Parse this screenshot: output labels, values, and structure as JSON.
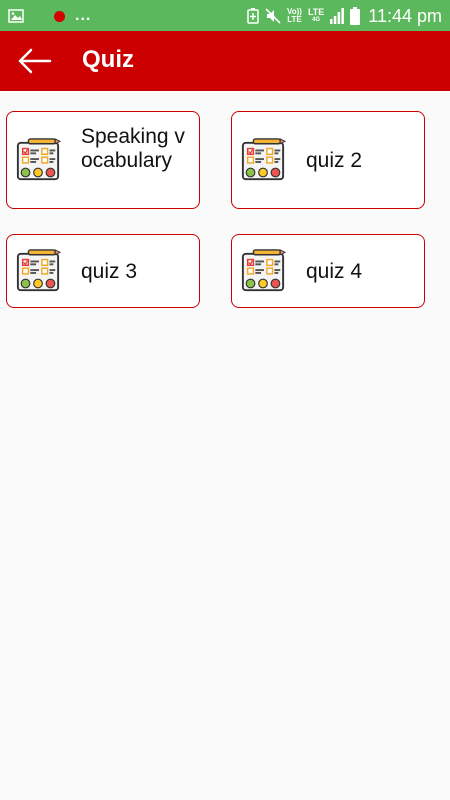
{
  "status_bar": {
    "time": "11:44 pm",
    "volte_top": "Vo))",
    "volte_bottom": "LTE",
    "lte_top": "LTE",
    "lte_bottom": "4G",
    "icons": [
      "gallery-icon",
      "recording-dot-icon",
      "battery-saver-icon",
      "mute-icon",
      "volte-icon",
      "lte-icon",
      "signal-icon",
      "battery-icon"
    ]
  },
  "header": {
    "title": "Quiz",
    "back_icon": "arrow-left-icon"
  },
  "quizzes": [
    {
      "label": "Speaking vocabulary",
      "icon": "quiz-checklist-icon"
    },
    {
      "label": "quiz 2",
      "icon": "quiz-checklist-icon"
    },
    {
      "label": "quiz 3",
      "icon": "quiz-checklist-icon"
    },
    {
      "label": "quiz 4",
      "icon": "quiz-checklist-icon"
    }
  ],
  "colors": {
    "status_bar": "#5cb85c",
    "app_bar": "#cc0000",
    "card_border": "#cc0000",
    "background": "#fafafa"
  }
}
